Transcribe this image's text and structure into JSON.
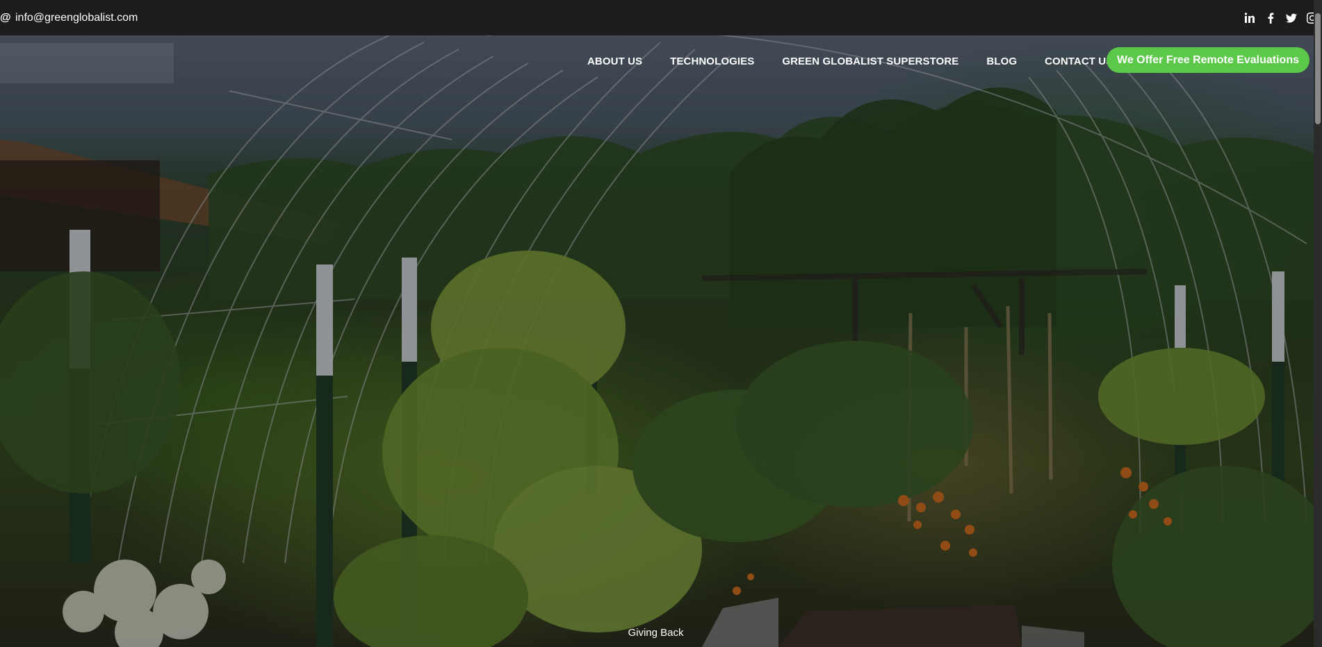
{
  "topbar": {
    "email": "info@greenglobalist.com",
    "socials": [
      {
        "icon": "linkedin-icon",
        "glyph": "in"
      },
      {
        "icon": "facebook-icon",
        "glyph": "f"
      },
      {
        "icon": "twitter-icon",
        "glyph": "t"
      },
      {
        "icon": "instagram-icon",
        "glyph": "ig"
      }
    ]
  },
  "nav": {
    "items": [
      {
        "label": "ABOUT US"
      },
      {
        "label": "TECHNOLOGIES"
      },
      {
        "label": "GREEN GLOBALIST SUPERSTORE"
      },
      {
        "label": "BLOG"
      },
      {
        "label": "CONTACT US"
      }
    ],
    "cta_label": "We Offer Free Remote Evaluations"
  },
  "hero": {
    "caption": "Giving Back"
  },
  "colors": {
    "topbar_bg": "#1c1c1c",
    "cta_bg": "#5cc84a",
    "text": "#ffffff"
  }
}
